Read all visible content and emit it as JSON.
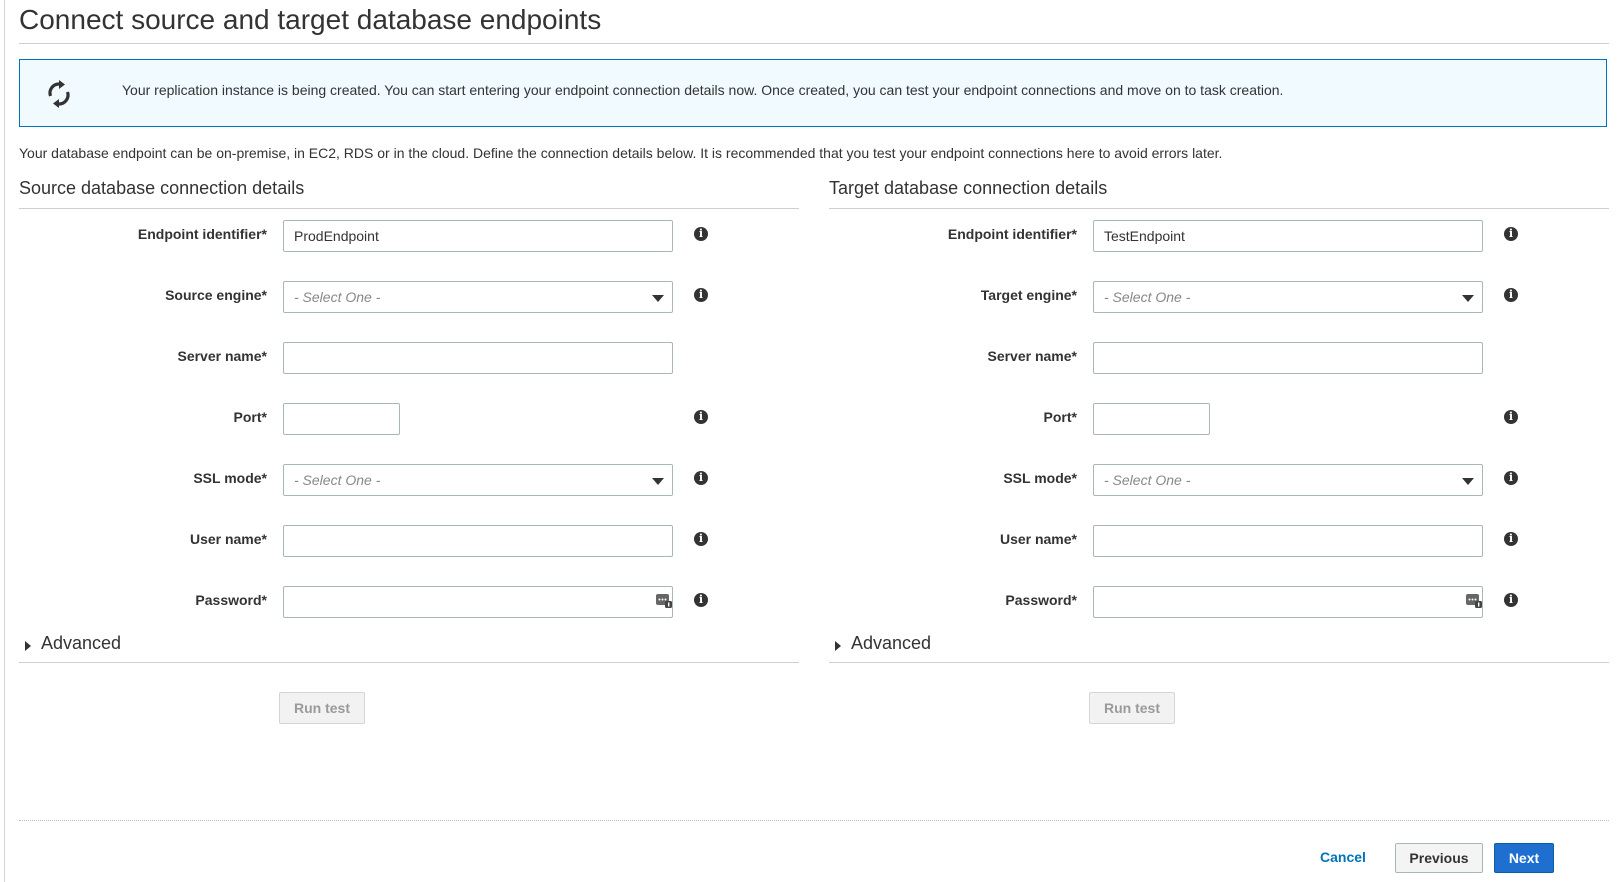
{
  "page": {
    "title": "Connect source and target database endpoints",
    "banner_text": "Your replication instance is being created. You can start entering your endpoint connection details now. Once created, you can test your endpoint connections and move on to task creation.",
    "intro_text": "Your database endpoint can be on-premise, in EC2, RDS or in the cloud. Define the connection details below. It is recommended that you test your endpoint connections here to avoid errors later."
  },
  "source": {
    "title": "Source database connection details",
    "endpoint_label": "Endpoint identifier*",
    "endpoint_value": "ProdEndpoint",
    "engine_label": "Source engine*",
    "engine_value": "- Select One -",
    "server_label": "Server name*",
    "server_value": "",
    "port_label": "Port*",
    "port_value": "",
    "ssl_label": "SSL mode*",
    "ssl_value": "- Select One -",
    "user_label": "User name*",
    "user_value": "",
    "password_label": "Password*",
    "password_value": "",
    "advanced_label": "Advanced",
    "run_test_label": "Run test"
  },
  "target": {
    "title": "Target database connection details",
    "endpoint_label": "Endpoint identifier*",
    "endpoint_value": "TestEndpoint",
    "engine_label": "Target engine*",
    "engine_value": "- Select One -",
    "server_label": "Server name*",
    "server_value": "",
    "port_label": "Port*",
    "port_value": "",
    "ssl_label": "SSL mode*",
    "ssl_value": "- Select One -",
    "user_label": "User name*",
    "user_value": "",
    "password_label": "Password*",
    "password_value": "",
    "advanced_label": "Advanced",
    "run_test_label": "Run test"
  },
  "footer": {
    "cancel_label": "Cancel",
    "previous_label": "Previous",
    "next_label": "Next"
  },
  "icons": {
    "banner": "refresh-icon",
    "info": "info-icon",
    "password": "password-manager-icon",
    "dropdown": "chevron-down-icon",
    "expand": "caret-right-icon"
  },
  "colors": {
    "accent": "#0073bb",
    "banner_bg": "#f1faff",
    "primary_button": "#1f6fd0"
  }
}
